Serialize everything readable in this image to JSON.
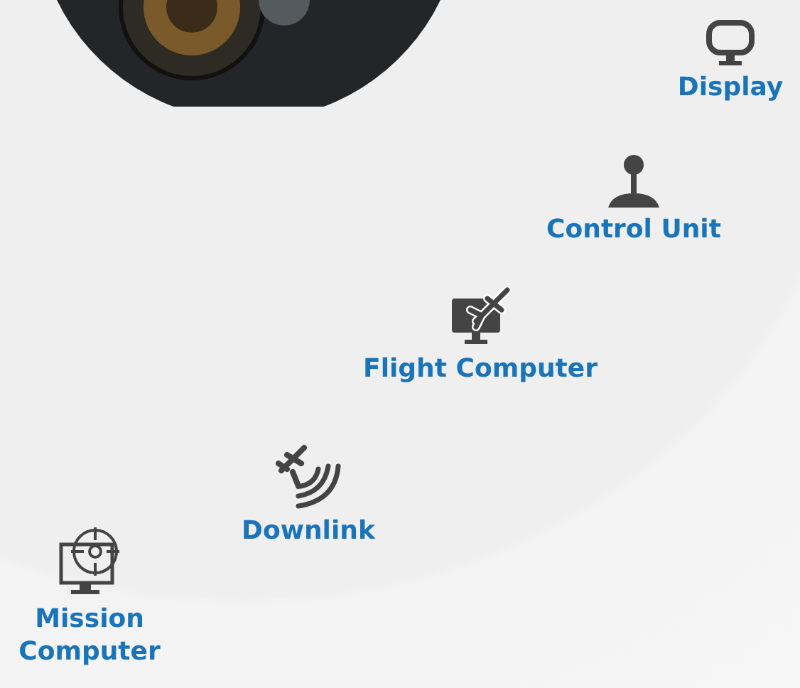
{
  "nodes": [
    {
      "kind": "display",
      "label": "Display"
    },
    {
      "kind": "joystick",
      "label": "Control Unit"
    },
    {
      "kind": "flight",
      "label": "Flight Computer"
    },
    {
      "kind": "downlink",
      "label": "Downlink"
    },
    {
      "kind": "mission",
      "label": "Mission Computer"
    }
  ]
}
